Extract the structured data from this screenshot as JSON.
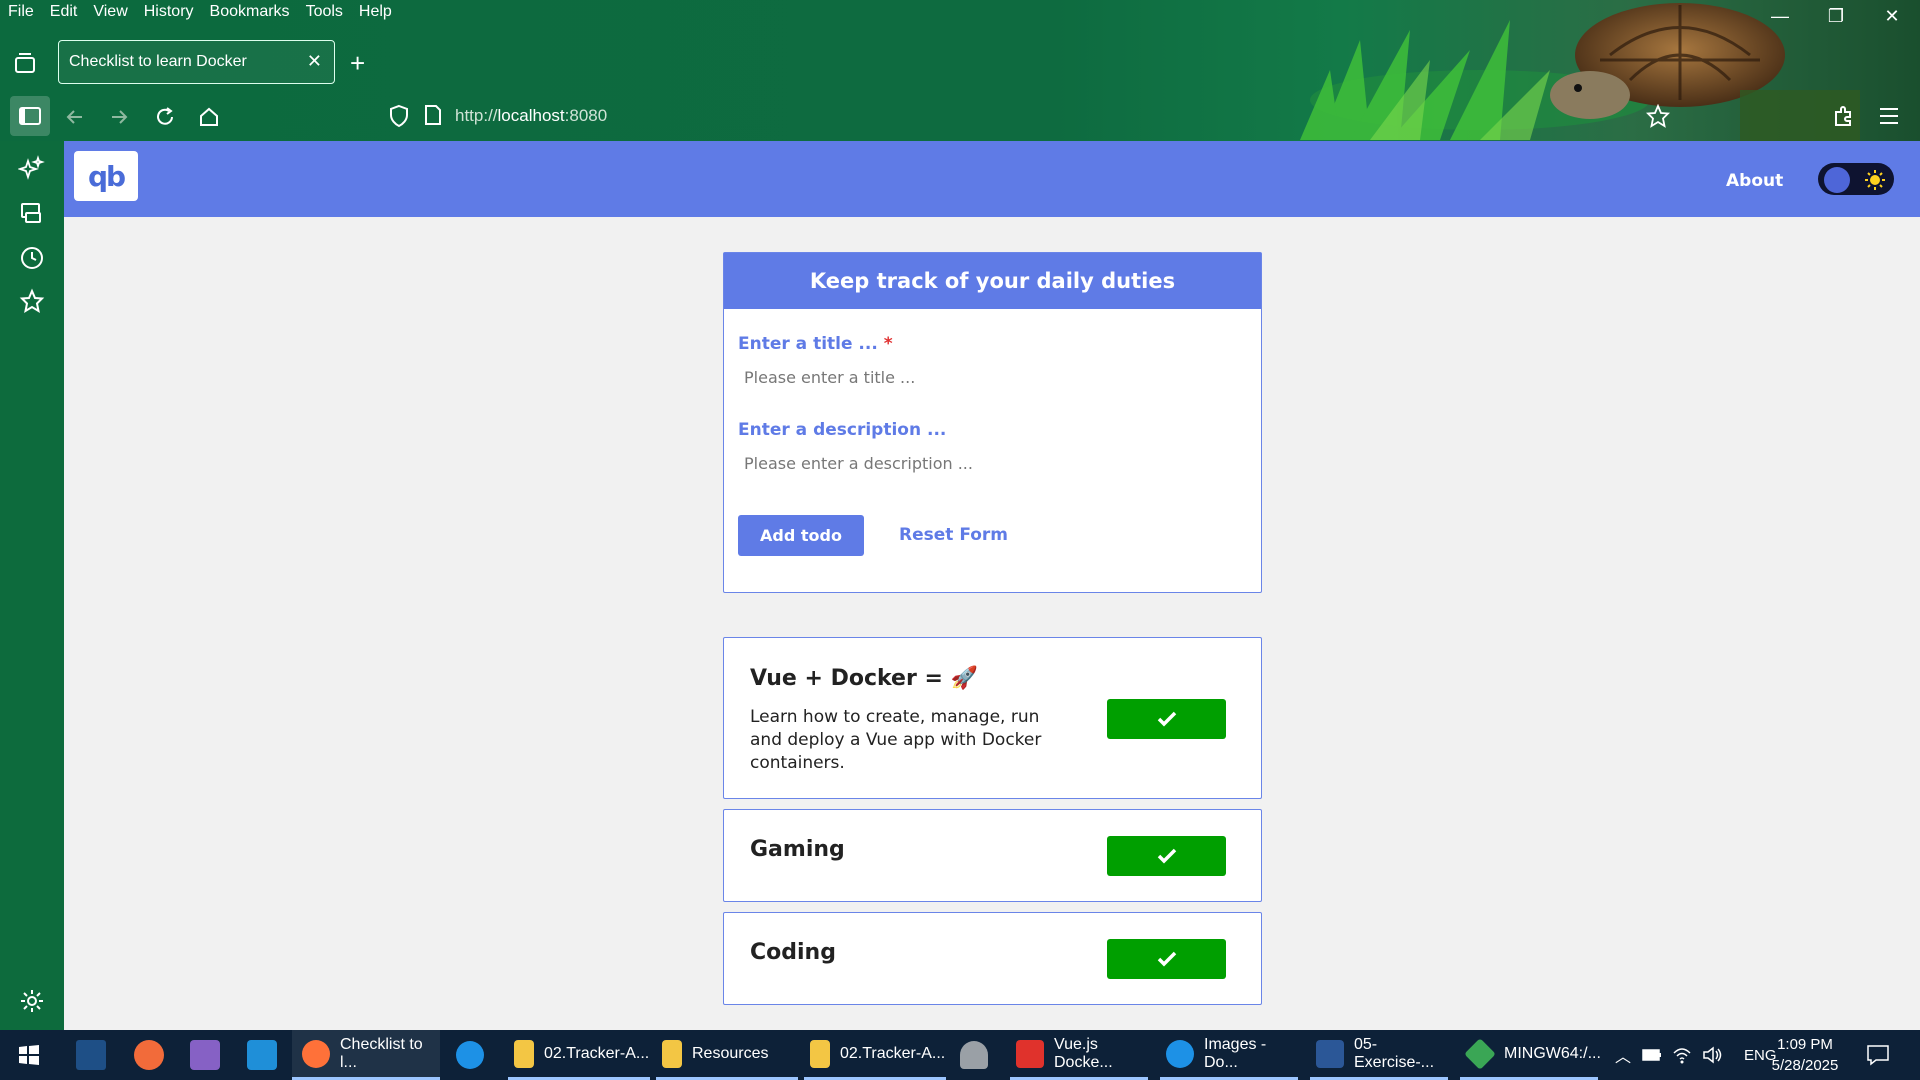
{
  "menu": [
    "File",
    "Edit",
    "View",
    "History",
    "Bookmarks",
    "Tools",
    "Help"
  ],
  "tab": {
    "title": "Checklist to learn Docker",
    "close": "✕",
    "new_tab": "+"
  },
  "window": {
    "minimize": "—",
    "restore": "❐",
    "close": "✕"
  },
  "address": {
    "url_prefix": "http://",
    "url_host": "localhost",
    "url_port": ":8080"
  },
  "app": {
    "logo_text": "qb",
    "nav_about": "About",
    "form": {
      "heading": "Keep track of your daily duties",
      "title_label": "Enter a title ...",
      "required_mark": "*",
      "title_placeholder": "Please enter a title ...",
      "desc_label": "Enter a description ...",
      "desc_placeholder": "Please enter a description ...",
      "add_button": "Add todo",
      "reset_button": "Reset Form"
    },
    "todos": [
      {
        "title": "Vue + Docker = 🚀",
        "description": "Learn how to create, manage, run and deploy a Vue app with Docker containers."
      },
      {
        "title": "Gaming",
        "description": ""
      },
      {
        "title": "Coding",
        "description": ""
      }
    ]
  },
  "taskbar": {
    "items": [
      {
        "label": "Checklist to l...",
        "color": "#ff7139"
      },
      {
        "label": "02.Tracker-A...",
        "color": "#f3c644"
      },
      {
        "label": "Resources",
        "color": "#f3c644"
      },
      {
        "label": "02.Tracker-A...",
        "color": "#f3c644"
      },
      {
        "label": "Vue.js Docke...",
        "color": "#e0322c"
      },
      {
        "label": "Images - Do...",
        "color": "#1d91e6"
      },
      {
        "label": "05-Exercise-...",
        "color": "#2b5797"
      },
      {
        "label": "MINGW64:/...",
        "color": "#3aa655"
      }
    ],
    "language": "ENG",
    "time": "1:09 PM",
    "date": "5/28/2025"
  },
  "colors": {
    "primary": "#5f7be6",
    "success": "#009f00",
    "browser_green": "#0d6b3d"
  }
}
